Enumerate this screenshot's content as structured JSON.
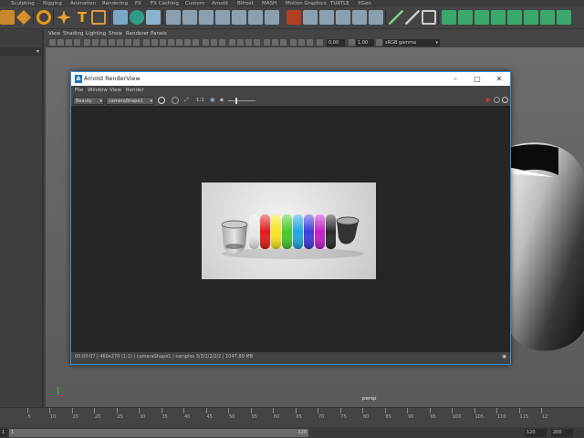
{
  "shelf": {
    "tabs": [
      "Sculpting",
      "Rigging",
      "Animation",
      "Rendering",
      "FX",
      "FX Caching",
      "Custom",
      "Arnold",
      "Bifrost",
      "MASH",
      "Motion Graphics",
      "TURTLE",
      "XGen"
    ]
  },
  "viewport": {
    "menus": [
      "View",
      "Shading",
      "Lighting",
      "Show",
      "Renderer",
      "Panels"
    ],
    "exposure": "0.00",
    "gamma": "1.00",
    "colorspace": "sRGB gamma",
    "camera_label": "persp"
  },
  "render_view": {
    "title": "Arnold RenderView",
    "logo_letter": "A",
    "menus": [
      "File",
      "Window",
      "View",
      "Render"
    ],
    "aov": "Beauty",
    "camera": "cameraShape1",
    "ratio": "1:1",
    "status": "00:00:07 | 460x270 (1:1) | cameraShape1 | samples 3/2/2/2/2/2 | 1047.89 MB"
  },
  "timeline": {
    "ticks": [
      "5",
      "10",
      "15",
      "20",
      "25",
      "30",
      "35",
      "40",
      "45",
      "50",
      "55",
      "60",
      "65",
      "70",
      "75",
      "80",
      "85",
      "90",
      "95",
      "100",
      "105",
      "110",
      "115",
      "12"
    ],
    "range_start": "1",
    "range_inner_start": "1",
    "range_inner_end": "120",
    "range_end_a": "120",
    "range_end_b": "200"
  },
  "colors": {
    "accent": "#2d8ed9",
    "ring_colors": [
      "#e7e7e7",
      "#e21a1a",
      "#f5e61b",
      "#45c92b",
      "#1ea7e0",
      "#3c3cd8",
      "#c31fc9",
      "#2a2a2a"
    ]
  }
}
